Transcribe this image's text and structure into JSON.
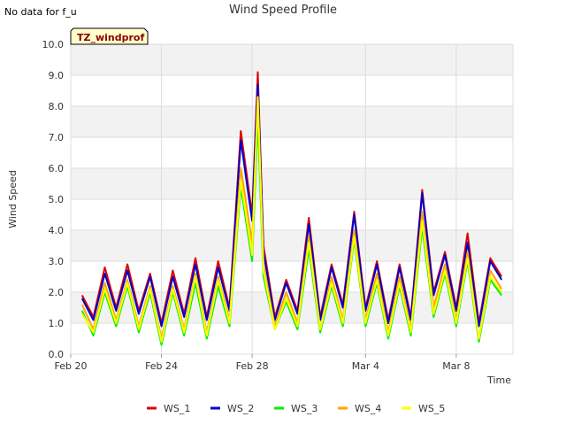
{
  "note": "No data for f_u",
  "site_label": "TZ_windprof",
  "chart_data": {
    "type": "line",
    "title": "Wind Speed Profile",
    "xlabel": "Time",
    "ylabel": "Wind Speed",
    "ylim": [
      0,
      10
    ],
    "yticks": [
      "0.0",
      "1.0",
      "2.0",
      "3.0",
      "4.0",
      "5.0",
      "6.0",
      "7.0",
      "8.0",
      "9.0",
      "10.0"
    ],
    "xlim": [
      "2024-02-20",
      "2024-03-10T12:00"
    ],
    "xticks": [
      {
        "date": "2024-02-20",
        "label": "Feb 20"
      },
      {
        "date": "2024-02-24",
        "label": "Feb 24"
      },
      {
        "date": "2024-02-28",
        "label": "Feb 28"
      },
      {
        "date": "2024-03-04",
        "label": "Mar 4"
      },
      {
        "date": "2024-03-08",
        "label": "Mar 8"
      }
    ],
    "grid": true,
    "legend_position": "bottom",
    "x": [
      "2024-02-20T12:00",
      "2024-02-21",
      "2024-02-21T12:00",
      "2024-02-22",
      "2024-02-22T12:00",
      "2024-02-23",
      "2024-02-23T12:00",
      "2024-02-24",
      "2024-02-24T12:00",
      "2024-02-25",
      "2024-02-25T12:00",
      "2024-02-26",
      "2024-02-26T12:00",
      "2024-02-27",
      "2024-02-27T12:00",
      "2024-02-28",
      "2024-02-28T06:00",
      "2024-02-28T12:00",
      "2024-02-29",
      "2024-02-29T12:00",
      "2024-03-01",
      "2024-03-01T12:00",
      "2024-03-02",
      "2024-03-02T12:00",
      "2024-03-03",
      "2024-03-03T12:00",
      "2024-03-04",
      "2024-03-04T12:00",
      "2024-03-05",
      "2024-03-05T12:00",
      "2024-03-06",
      "2024-03-06T12:00",
      "2024-03-07",
      "2024-03-07T12:00",
      "2024-03-08",
      "2024-03-08T12:00",
      "2024-03-09",
      "2024-03-09T12:00",
      "2024-03-10"
    ],
    "series": [
      {
        "name": "WS_1",
        "color": "#dd0000",
        "values": [
          1.9,
          1.2,
          2.8,
          1.5,
          2.9,
          1.4,
          2.6,
          1.0,
          2.7,
          1.3,
          3.1,
          1.2,
          3.0,
          1.5,
          7.2,
          4.5,
          9.1,
          3.5,
          1.2,
          2.4,
          1.4,
          4.4,
          1.2,
          2.9,
          1.6,
          4.6,
          1.5,
          3.0,
          1.1,
          2.9,
          1.2,
          5.3,
          2.0,
          3.3,
          1.5,
          3.9,
          1.0,
          3.1,
          2.5
        ]
      },
      {
        "name": "WS_2",
        "color": "#0000cc",
        "values": [
          1.8,
          1.1,
          2.6,
          1.4,
          2.7,
          1.3,
          2.5,
          0.9,
          2.5,
          1.2,
          2.9,
          1.1,
          2.8,
          1.4,
          6.9,
          4.3,
          8.7,
          3.3,
          1.1,
          2.3,
          1.3,
          4.2,
          1.1,
          2.8,
          1.5,
          4.5,
          1.4,
          2.9,
          1.0,
          2.8,
          1.1,
          5.2,
          1.9,
          3.2,
          1.4,
          3.6,
          0.9,
          3.0,
          2.4
        ]
      },
      {
        "name": "WS_3",
        "color": "#00ee00",
        "values": [
          1.4,
          0.6,
          2.0,
          0.9,
          2.2,
          0.7,
          2.0,
          0.3,
          2.0,
          0.6,
          2.3,
          0.5,
          2.2,
          0.9,
          5.4,
          3.0,
          7.6,
          2.5,
          0.8,
          1.7,
          0.8,
          3.4,
          0.7,
          2.2,
          0.9,
          3.7,
          0.9,
          2.3,
          0.5,
          2.2,
          0.6,
          4.1,
          1.2,
          2.6,
          0.9,
          3.0,
          0.4,
          2.4,
          1.9
        ]
      },
      {
        "name": "WS_4",
        "color": "#ffa500",
        "values": [
          1.6,
          0.8,
          2.3,
          1.1,
          2.4,
          0.9,
          2.2,
          0.5,
          2.2,
          0.8,
          2.6,
          0.7,
          2.5,
          1.1,
          6.0,
          3.6,
          8.2,
          2.9,
          0.9,
          2.0,
          1.0,
          3.8,
          0.8,
          2.5,
          1.1,
          4.0,
          1.1,
          2.6,
          0.7,
          2.5,
          0.8,
          4.6,
          1.5,
          2.9,
          1.1,
          3.3,
          0.5,
          2.7,
          2.1
        ]
      },
      {
        "name": "WS_5",
        "color": "#ffff00",
        "values": [
          1.3,
          0.7,
          2.1,
          1.0,
          2.3,
          0.8,
          2.1,
          0.4,
          2.1,
          0.7,
          2.5,
          0.6,
          2.4,
          1.0,
          5.6,
          3.2,
          8.3,
          2.7,
          0.8,
          1.8,
          0.9,
          3.6,
          0.8,
          2.3,
          1.0,
          3.8,
          1.0,
          2.4,
          0.6,
          2.3,
          0.7,
          4.3,
          1.3,
          2.7,
          1.0,
          3.1,
          0.5,
          2.5,
          2.0
        ]
      }
    ]
  }
}
